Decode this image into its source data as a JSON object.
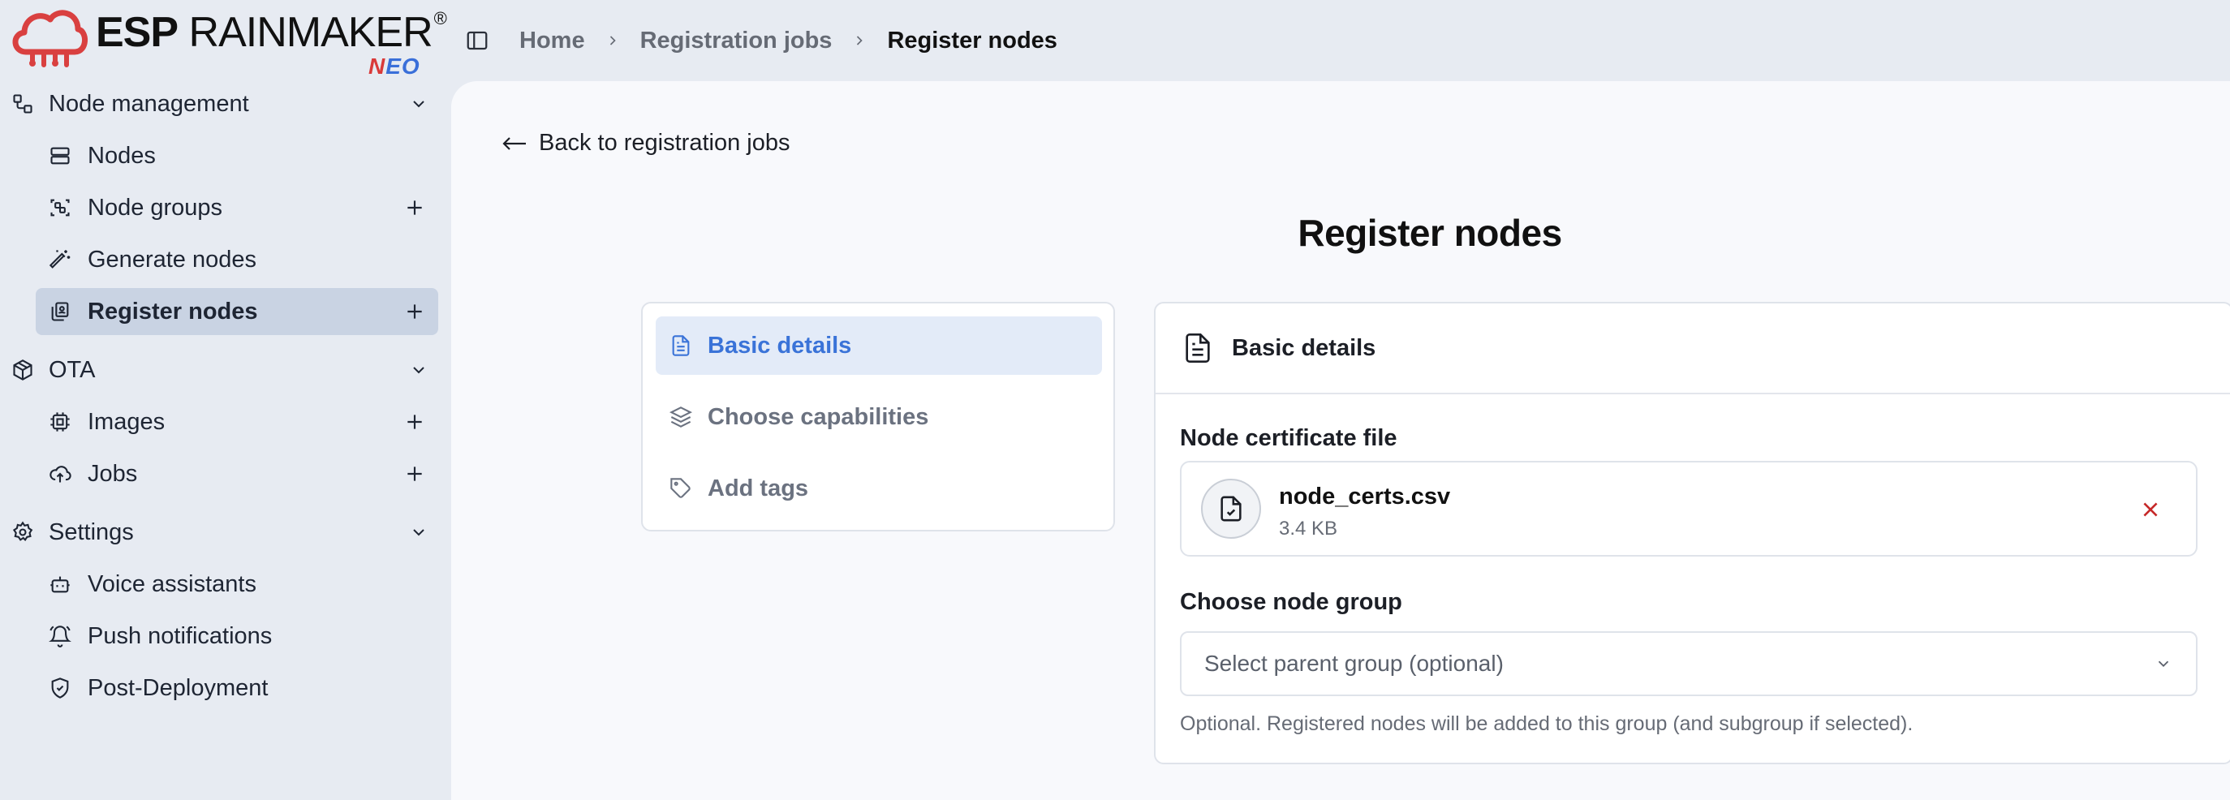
{
  "brand": {
    "name_bold": "ESP",
    "name_rest": " RAINMAKER",
    "reg": "®",
    "sub_n": "N",
    "sub_eo": "EO"
  },
  "sidebar": {
    "sections": [
      {
        "label": "Node management",
        "items": [
          {
            "label": "Nodes",
            "icon": "server-icon",
            "plus": false
          },
          {
            "label": "Node groups",
            "icon": "group-icon",
            "plus": true
          },
          {
            "label": "Generate nodes",
            "icon": "magic-wand-icon",
            "plus": false
          },
          {
            "label": "Register nodes",
            "icon": "register-icon",
            "plus": true,
            "active": true
          }
        ]
      },
      {
        "label": "OTA",
        "items": [
          {
            "label": "Images",
            "icon": "chip-icon",
            "plus": true
          },
          {
            "label": "Jobs",
            "icon": "cloud-upload-icon",
            "plus": true
          }
        ]
      },
      {
        "label": "Settings",
        "items": [
          {
            "label": "Voice assistants",
            "icon": "bot-icon",
            "plus": false
          },
          {
            "label": "Push notifications",
            "icon": "bell-icon",
            "plus": false
          },
          {
            "label": "Post-Deployment",
            "icon": "shield-icon",
            "plus": false
          }
        ]
      }
    ]
  },
  "breadcrumb": [
    "Home",
    "Registration jobs",
    "Register nodes"
  ],
  "main": {
    "back_label": "Back to registration jobs",
    "title": "Register nodes",
    "steps": [
      {
        "label": "Basic details",
        "active": true
      },
      {
        "label": "Choose capabilities",
        "active": false
      },
      {
        "label": "Add tags",
        "active": false
      }
    ],
    "card": {
      "title": "Basic details",
      "cert_label": "Node certificate file",
      "file_name": "node_certs.csv",
      "file_size": "3.4 KB",
      "group_label": "Choose node group",
      "group_placeholder": "Select parent group (optional)",
      "group_hint": "Optional. Registered nodes will be added to this group (and subgroup if selected)."
    }
  },
  "colors": {
    "accent": "#3a73d8",
    "danger": "#c62828",
    "sidebar_bg": "#e7ebf2",
    "active_item": "#c9d3e3"
  }
}
